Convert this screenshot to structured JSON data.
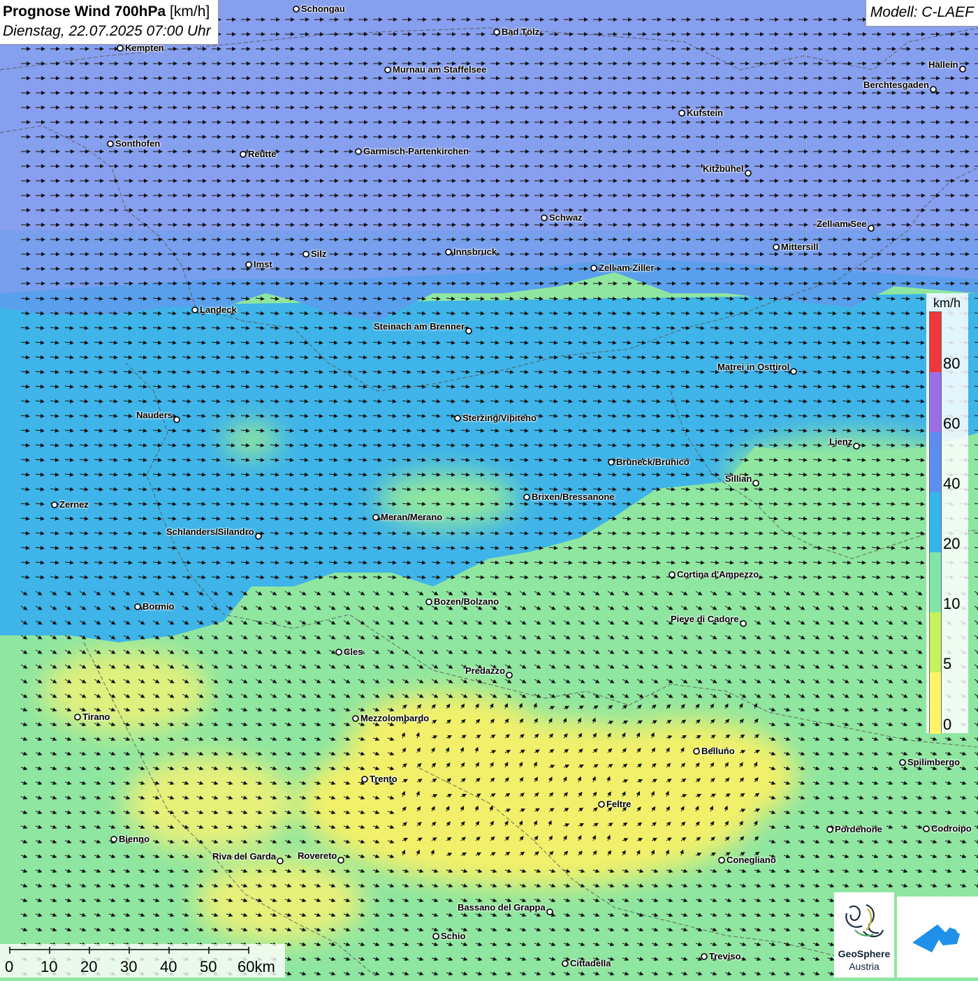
{
  "title": {
    "main": "Prognose Wind 700hPa",
    "unit": "[km/h]",
    "datetime": "Dienstag, 22.07.2025 07:00 Uhr"
  },
  "model": "Modell: C-LAEF",
  "legend": {
    "unit": "km/h",
    "ticks": [
      "80",
      "60",
      "40",
      "20",
      "10",
      "5",
      "0"
    ],
    "colors": [
      "#f03838",
      "#9b6ee6",
      "#5b8ef0",
      "#33b6ea",
      "#7fe6a8",
      "#c6f25a",
      "#fff36a"
    ]
  },
  "colors": {
    "zone_purple": "#8f9ff0",
    "zone_blue": "#5aa8ec",
    "zone_cyan": "#3fb4e8",
    "zone_green": "#8fe6a0",
    "zone_yellow": "#f2f06a"
  },
  "cities": [
    {
      "name": "Schongau"
    },
    {
      "name": "Bad Tölz"
    },
    {
      "name": "Kempten"
    },
    {
      "name": "Murnau am Staffelsee"
    },
    {
      "name": "Hallein"
    },
    {
      "name": "Berchtesgaden"
    },
    {
      "name": "Kufstein"
    },
    {
      "name": "Sonthofen"
    },
    {
      "name": "Reutte"
    },
    {
      "name": "Garmisch-Partenkirchen"
    },
    {
      "name": "Kitzbühel"
    },
    {
      "name": "Schwaz"
    },
    {
      "name": "Zell am See"
    },
    {
      "name": "Mittersill"
    },
    {
      "name": "Imst"
    },
    {
      "name": "Silz"
    },
    {
      "name": "Innsbruck"
    },
    {
      "name": "Zell am Ziller"
    },
    {
      "name": "Landeck"
    },
    {
      "name": "Steinach am Brenner"
    },
    {
      "name": "Matrei in Osttirol"
    },
    {
      "name": "Nauders"
    },
    {
      "name": "Sterzing/Vipiteno"
    },
    {
      "name": "Lienz"
    },
    {
      "name": "Bruneck/Brunico"
    },
    {
      "name": "Sillian"
    },
    {
      "name": "Zernez"
    },
    {
      "name": "Brixen/Bressanone"
    },
    {
      "name": "Meran/Merano"
    },
    {
      "name": "Schlanders/Silandro"
    },
    {
      "name": "Cortina d'Ampezzo"
    },
    {
      "name": "Bormio"
    },
    {
      "name": "Bozen/Bolzano"
    },
    {
      "name": "Pieve di Cadore"
    },
    {
      "name": "Cles"
    },
    {
      "name": "Predazzo"
    },
    {
      "name": "Tirano"
    },
    {
      "name": "Mezzolombardo"
    },
    {
      "name": "Belluno"
    },
    {
      "name": "Spilimbergo"
    },
    {
      "name": "Trento"
    },
    {
      "name": "Feltre"
    },
    {
      "name": "Pordenone"
    },
    {
      "name": "Codroipo"
    },
    {
      "name": "Bienno"
    },
    {
      "name": "Riva del Garda"
    },
    {
      "name": "Rovereto"
    },
    {
      "name": "Conegliano"
    },
    {
      "name": "Bassano del Grappa"
    },
    {
      "name": "Schio"
    },
    {
      "name": "Treviso"
    },
    {
      "name": "Cittadella"
    }
  ],
  "scale": {
    "labels": [
      "0",
      "10",
      "20",
      "30",
      "40",
      "50",
      "60km"
    ]
  },
  "logo": {
    "org_line1": "GeoSphere",
    "org_line2": "Austria"
  }
}
